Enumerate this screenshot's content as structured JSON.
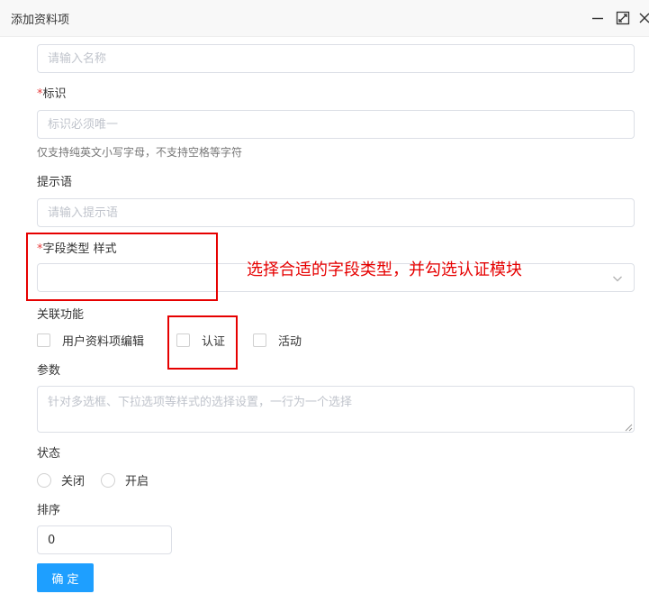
{
  "dialog": {
    "title": "添加资料项"
  },
  "form": {
    "name_placeholder": "请输入名称",
    "identifier": {
      "required_mark": "*",
      "label": "标识",
      "placeholder": "标识必须唯一",
      "hint": "仅支持纯英文小写字母，不支持空格等字符"
    },
    "prompt": {
      "label": "提示语",
      "placeholder": "请输入提示语"
    },
    "field_type": {
      "required_mark": "*",
      "label": "字段类型 样式",
      "value": ""
    },
    "related": {
      "label": "关联功能",
      "options": [
        {
          "label": "用户资料项编辑",
          "checked": false
        },
        {
          "label": "认证",
          "checked": false
        },
        {
          "label": "活动",
          "checked": false
        }
      ]
    },
    "params": {
      "label": "参数",
      "placeholder": "针对多选框、下拉选项等样式的选择设置，一行为一个选择"
    },
    "status": {
      "label": "状态",
      "options": [
        {
          "label": "关闭",
          "selected": false
        },
        {
          "label": "开启",
          "selected": false
        }
      ]
    },
    "sort": {
      "label": "排序",
      "value": "0"
    },
    "confirm_label": "确定"
  },
  "annotation": {
    "text": "选择合适的字段类型，并勾选认证模块",
    "color": "#e60000"
  },
  "icons": {
    "minimize": "minimize-icon",
    "maximize": "maximize-icon",
    "close": "close-icon",
    "dropdown": "chevron-down-icon"
  },
  "colors": {
    "primary": "#1e9fff",
    "required": "#e83e3e",
    "annotation": "#e60000"
  }
}
